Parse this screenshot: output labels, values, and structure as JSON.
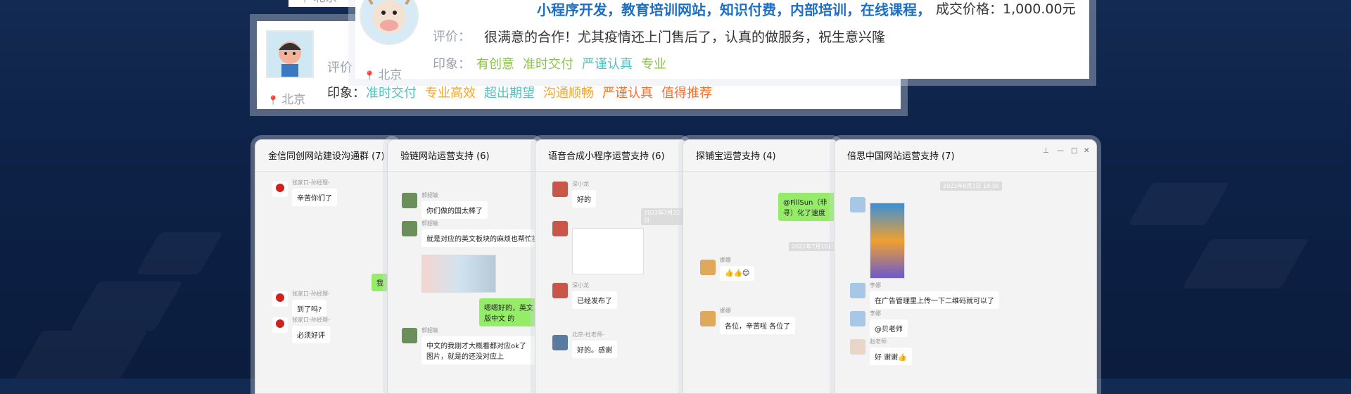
{
  "review_front": {
    "services_text": "小程序开发，教育培训网站，知识付费，内部培训，在线课程，",
    "price_text": "成交价格：1,000.00元",
    "review_label": "评价：",
    "review_text": "很满意的合作！尤其疫情还上门售后了，认真的做服务，祝生意兴隆",
    "impression_label": "印象：",
    "tags": [
      {
        "text": "有创意",
        "color": "#8bc34a"
      },
      {
        "text": "准时交付",
        "color": "#8bc34a"
      },
      {
        "text": "严谨认真",
        "color": "#4fc3c0"
      },
      {
        "text": "专业",
        "color": "#8bc34a"
      }
    ],
    "location": "北京",
    "avatar_icon": "cartoon-cow-avatar-icon"
  },
  "review_back": {
    "review_label": "评价",
    "impression_label": "印象：",
    "location": "北京",
    "top_location": "北京",
    "tags": [
      {
        "text": "准时交付",
        "color": "#4fc3c0"
      },
      {
        "text": "专业高效",
        "color": "#f5a623"
      },
      {
        "text": "超出期望",
        "color": "#4fc3c0"
      },
      {
        "text": "沟通顺畅",
        "color": "#f5a623"
      },
      {
        "text": "严谨认真",
        "color": "#f36f2a"
      },
      {
        "text": "值得推荐",
        "color": "#f36f2a"
      }
    ],
    "avatar_icon": "cartoon-boy-avatar-icon"
  },
  "chats": [
    {
      "title": "金信同创网站建设沟通群 (7)",
      "messages": [
        {
          "name": "张家口-孙经理-",
          "text": "辛苦你们了"
        },
        {
          "name": "张家口-孙经理-",
          "text": "到了吗?"
        },
        {
          "name": "张家口-孙经理-",
          "text": "必须好评"
        }
      ],
      "green_fragment": "我"
    },
    {
      "title": "验链网站运营支持 (6)",
      "messages": [
        {
          "name": "郭韶敏",
          "text": "你们做的国太棒了"
        },
        {
          "name": "郭韶敏",
          "text": "就是对应的英文板块的麻烦也帮忙换上"
        },
        {
          "name": "郭韶敏",
          "text": "中文的我刚才大概看都对应ok了图片，就是的还没对应上"
        }
      ],
      "green_text": "嗯嗯好的，英文版中文 的"
    },
    {
      "title": "语音合成小程序运营支持 (6)",
      "messages": [
        {
          "name": "深小龙",
          "text": "好的"
        },
        {
          "name": "深小龙",
          "text": "已经发布了"
        },
        {
          "name": "北京-杜老师-",
          "text": "好的。感谢"
        }
      ],
      "timestamp": "2022年7月22日"
    },
    {
      "title": "探铺宝运营支持 (4)",
      "messages": [
        {
          "name": "娜娜",
          "text": "👍👍😊"
        },
        {
          "name": "娜娜",
          "text": "各位，辛苦啦 各位了"
        }
      ],
      "green_text": "@FillSun（非寻）化了速度",
      "timestamp": "2022年7月10日"
    },
    {
      "title": "倍思中国网站运营支持 (7)",
      "messages": [
        {
          "name": "李娜",
          "text": "在广告管理里上传一下二维码就可以了"
        },
        {
          "name": "李娜",
          "text": "@贝老师"
        },
        {
          "name": "赵老师",
          "text": "好 谢谢👍"
        }
      ],
      "timestamp": "2022年8月1日 18:00"
    }
  ]
}
